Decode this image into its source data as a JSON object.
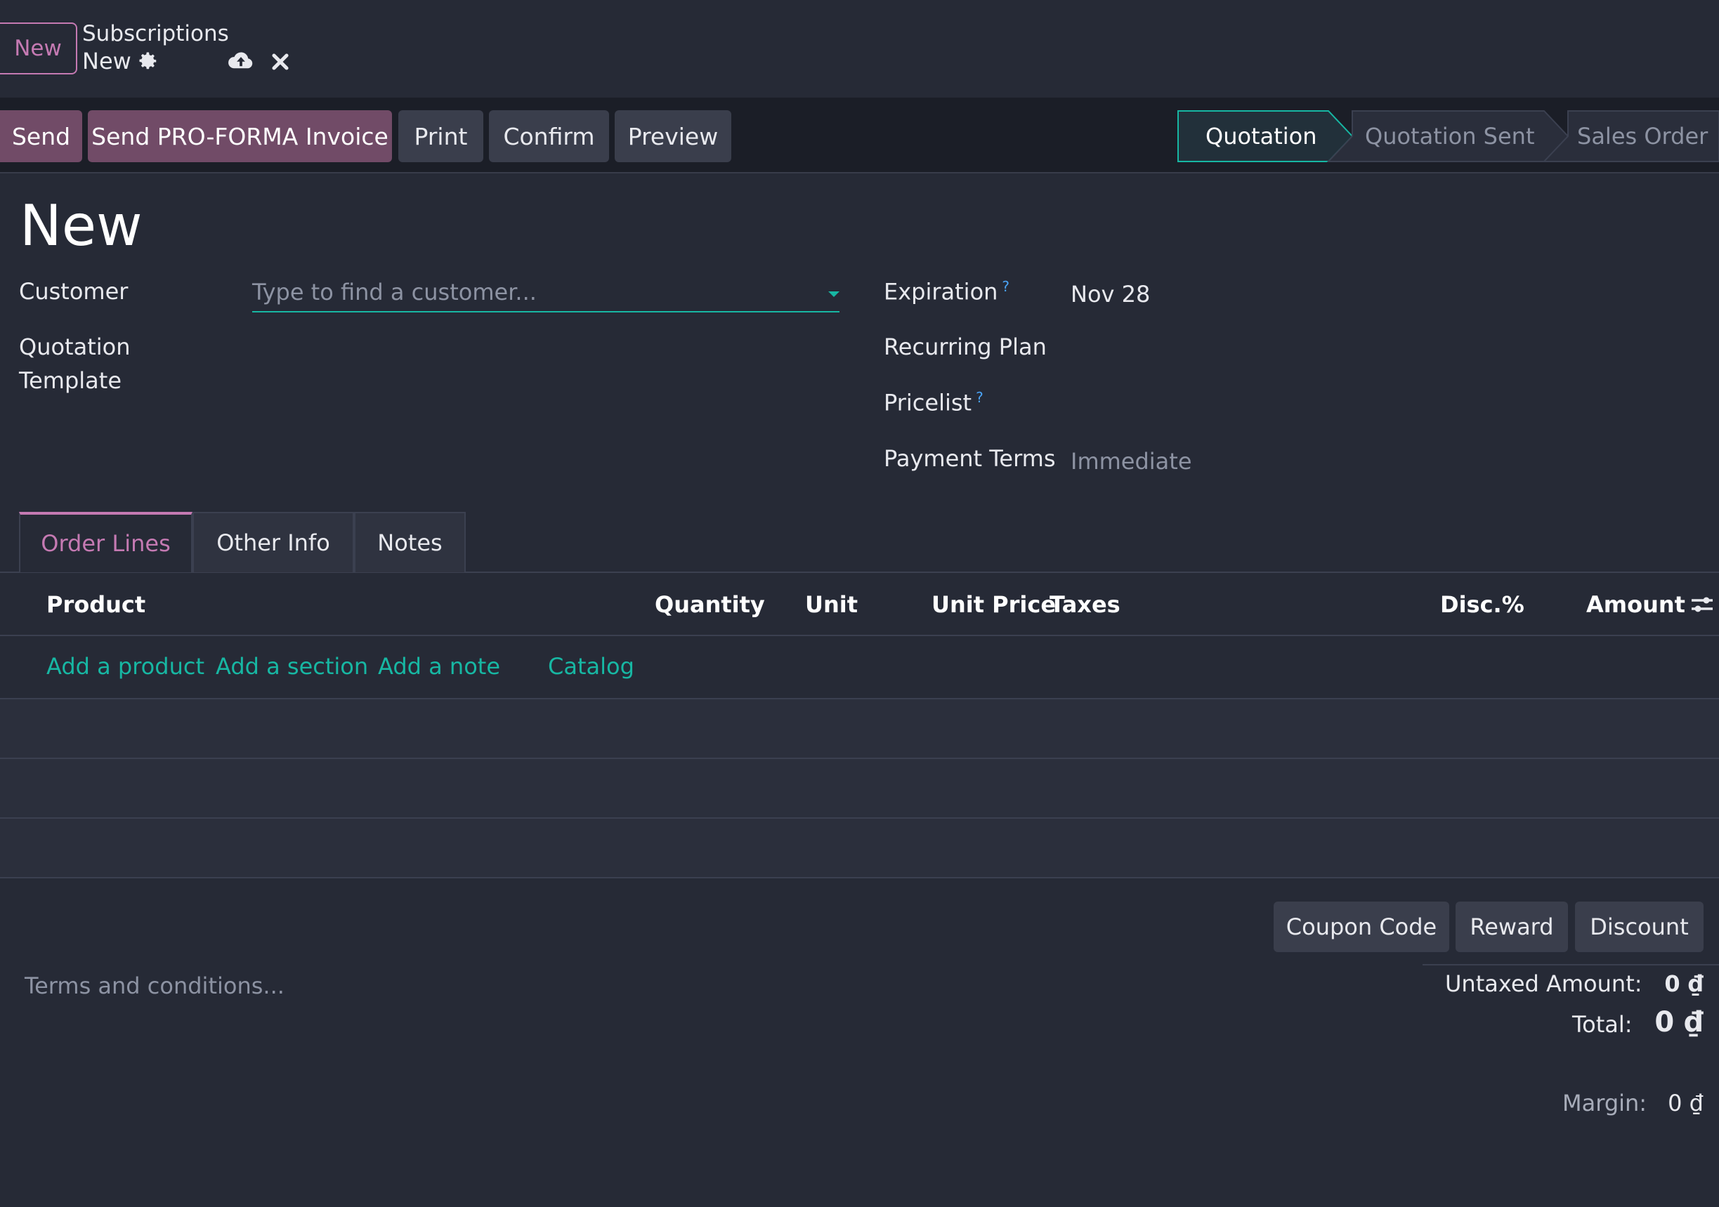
{
  "breadcrumb": {
    "new_button": "New",
    "module": "Subscriptions",
    "record": "New"
  },
  "toolbar": {
    "send": "Send",
    "send_proforma": "Send PRO-FORMA Invoice",
    "print": "Print",
    "confirm": "Confirm",
    "preview": "Preview"
  },
  "status": {
    "stages": [
      "Quotation",
      "Quotation Sent",
      "Sales Order"
    ],
    "active": "Quotation"
  },
  "form": {
    "title": "New",
    "customer_label": "Customer",
    "customer_placeholder": "Type to find a customer...",
    "template_label_1": "Quotation",
    "template_label_2": "Template",
    "expiration_label": "Expiration",
    "expiration_value": "Nov 28",
    "recurring_label": "Recurring Plan",
    "pricelist_label": "Pricelist",
    "payment_terms_label": "Payment Terms",
    "payment_terms_placeholder": "Immediate",
    "help_mark": "?"
  },
  "tabs": [
    "Order Lines",
    "Other Info",
    "Notes"
  ],
  "table": {
    "headers": [
      "Product",
      "Quantity",
      "Unit",
      "Unit Price",
      "Taxes",
      "Disc.%",
      "Amount"
    ],
    "links": [
      "Add a product",
      "Add a section",
      "Add a note",
      "Catalog"
    ]
  },
  "footer": {
    "buttons": [
      "Coupon Code",
      "Reward",
      "Discount"
    ],
    "terms_placeholder": "Terms and conditions...",
    "untaxed_label": "Untaxed Amount:",
    "untaxed_value": "0 ₫",
    "total_label": "Total:",
    "total_value": "0 ₫",
    "margin_label": "Margin:",
    "margin_value": "0 ₫"
  },
  "colors": {
    "accent_purple": "#714b67",
    "accent_teal": "#17b7a3",
    "background": "#262a36"
  }
}
